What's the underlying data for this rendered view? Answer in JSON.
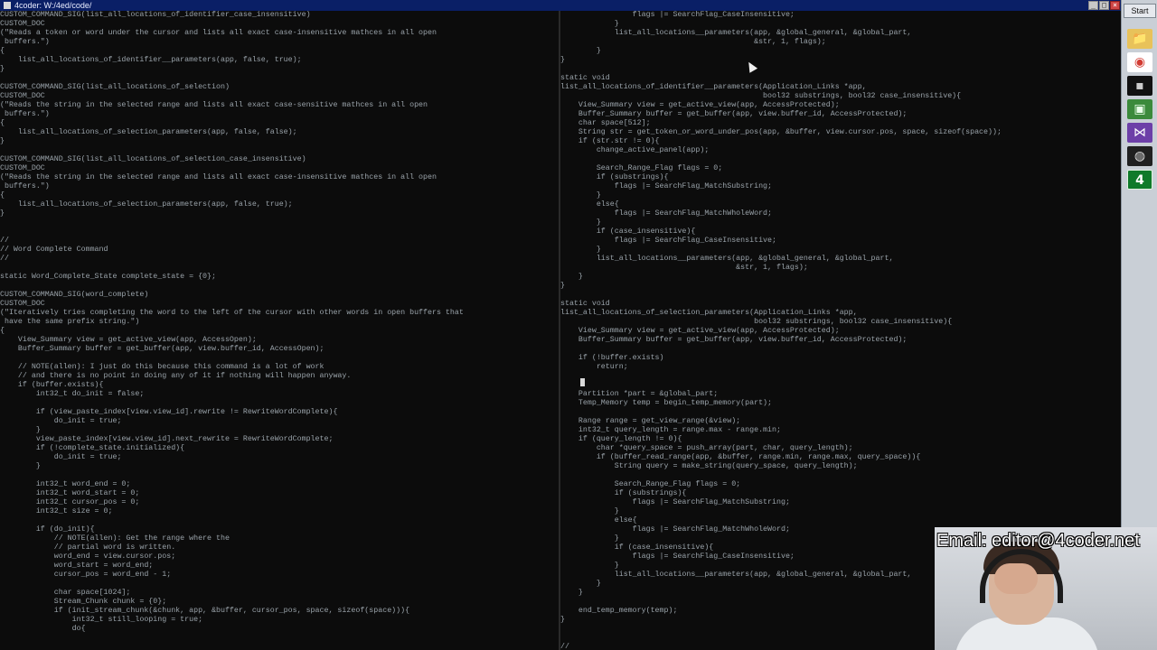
{
  "window": {
    "title": "4coder: W:/4ed/code/"
  },
  "taskbar": {
    "start_label": "Start",
    "items": [
      {
        "name": "file-explorer-icon",
        "glyph": "📁"
      },
      {
        "name": "chrome-icon",
        "glyph": "◉"
      },
      {
        "name": "terminal-icon",
        "glyph": "▪"
      },
      {
        "name": "app-icon",
        "glyph": "▣"
      },
      {
        "name": "visual-studio-icon",
        "glyph": "⋈"
      },
      {
        "name": "obs-icon",
        "glyph": "◍"
      },
      {
        "name": "4coder-icon",
        "glyph": "4"
      }
    ]
  },
  "overlay": {
    "email": "Email: editor@4coder.net"
  },
  "left_code": "CUSTOM_COMMAND_SIG(list_all_locations_of_identifier_case_insensitive)\nCUSTOM_DOC\n(\"Reads a token or word under the cursor and lists all exact case-insensitive mathces in all open\n buffers.\")\n{\n    list_all_locations_of_identifier__parameters(app, false, true);\n}\n\nCUSTOM_COMMAND_SIG(list_all_locations_of_selection)\nCUSTOM_DOC\n(\"Reads the string in the selected range and lists all exact case-sensitive mathces in all open\n buffers.\")\n{\n    list_all_locations_of_selection_parameters(app, false, false);\n}\n\nCUSTOM_COMMAND_SIG(list_all_locations_of_selection_case_insensitive)\nCUSTOM_DOC\n(\"Reads the string in the selected range and lists all exact case-insensitive mathces in all open\n buffers.\")\n{\n    list_all_locations_of_selection_parameters(app, false, true);\n}\n\n\n//\n// Word Complete Command\n//\n\nstatic Word_Complete_State complete_state = {0};\n\nCUSTOM_COMMAND_SIG(word_complete)\nCUSTOM_DOC\n(\"Iteratively tries completing the word to the left of the cursor with other words in open buffers that\n have the same prefix string.\")\n{\n    View_Summary view = get_active_view(app, AccessOpen);\n    Buffer_Summary buffer = get_buffer(app, view.buffer_id, AccessOpen);\n    \n    // NOTE(allen): I just do this because this command is a lot of work\n    // and there is no point in doing any of it if nothing will happen anyway.\n    if (buffer.exists){\n        int32_t do_init = false;\n        \n        if (view_paste_index[view.view_id].rewrite != RewriteWordComplete){\n            do_init = true;\n        }\n        view_paste_index[view.view_id].next_rewrite = RewriteWordComplete;\n        if (!complete_state.initialized){\n            do_init = true;\n        }\n        \n        int32_t word_end = 0;\n        int32_t word_start = 0;\n        int32_t cursor_pos = 0;\n        int32_t size = 0;\n        \n        if (do_init){\n            // NOTE(allen): Get the range where the\n            // partial word is written.\n            word_end = view.cursor.pos;\n            word_start = word_end;\n            cursor_pos = word_end - 1;\n            \n            char space[1024];\n            Stream_Chunk chunk = {0};\n            if (init_stream_chunk(&chunk, app, &buffer, cursor_pos, space, sizeof(space))){\n                int32_t still_looping = true;\n                do{",
  "right_code": "                flags |= SearchFlag_CaseInsensitive;\n            }\n            list_all_locations__parameters(app, &global_general, &global_part,\n                                           &str, 1, flags);\n        }\n}\n\nstatic void\nlist_all_locations_of_identifier__parameters(Application_Links *app,\n                                             bool32 substrings, bool32 case_insensitive){\n    View_Summary view = get_active_view(app, AccessProtected);\n    Buffer_Summary buffer = get_buffer(app, view.buffer_id, AccessProtected);\n    char space[512];\n    String str = get_token_or_word_under_pos(app, &buffer, view.cursor.pos, space, sizeof(space));\n    if (str.str != 0){\n        change_active_panel(app);\n        \n        Search_Range_Flag flags = 0;\n        if (substrings){\n            flags |= SearchFlag_MatchSubstring;\n        }\n        else{\n            flags |= SearchFlag_MatchWholeWord;\n        }\n        if (case_insensitive){\n            flags |= SearchFlag_CaseInsensitive;\n        }\n        list_all_locations__parameters(app, &global_general, &global_part,\n                                       &str, 1, flags);\n    }\n}\n\nstatic void\nlist_all_locations_of_selection_parameters(Application_Links *app,\n                                           bool32 substrings, bool32 case_insensitive){\n    View_Summary view = get_active_view(app, AccessProtected);\n    Buffer_Summary buffer = get_buffer(app, view.buffer_id, AccessProtected);\n    \n    if (!buffer.exists)\n        return;\n    \n    \n    Partition *part = &global_part;\n    Temp_Memory temp = begin_temp_memory(part);\n    \n    Range range = get_view_range(&view);\n    int32_t query_length = range.max - range.min;\n    if (query_length != 0){\n        char *query_space = push_array(part, char, query_length);\n        if (buffer_read_range(app, &buffer, range.min, range.max, query_space)){\n            String query = make_string(query_space, query_length);\n            \n            Search_Range_Flag flags = 0;\n            if (substrings){\n                flags |= SearchFlag_MatchSubstring;\n            }\n            else{\n                flags |= SearchFlag_MatchWholeWord;\n            }\n            if (case_insensitive){\n                flags |= SearchFlag_CaseInsensitive;\n            }\n            list_all_locations__parameters(app, &global_general, &global_part,\n        }\n    }\n    \n    end_temp_memory(temp);\n}\n\n\n//"
}
